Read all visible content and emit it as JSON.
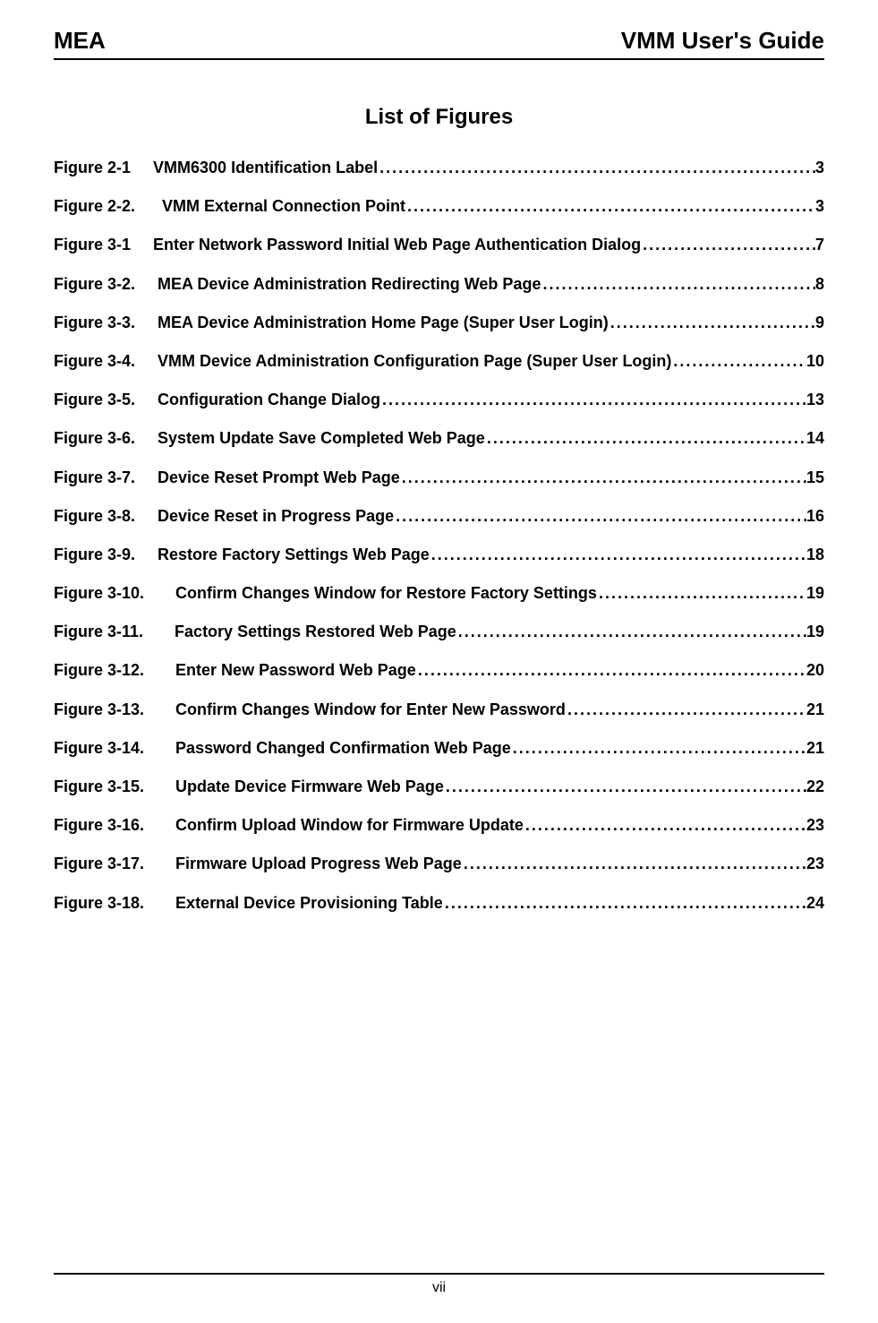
{
  "header": {
    "left": "MEA",
    "right": "VMM User's Guide"
  },
  "title": "List of Figures",
  "entries": [
    {
      "label": "Figure 2-1",
      "spacing": "     ",
      "title": "VMM6300 Identification Label ",
      "page": "3"
    },
    {
      "label": "Figure 2-2.",
      "spacing": "      ",
      "title": "VMM External Connection Point ",
      "page": "3"
    },
    {
      "label": "Figure 3-1",
      "spacing": "     ",
      "title": "Enter Network Password Initial Web Page Authentication Dialog ",
      "page": "7"
    },
    {
      "label": "Figure 3-2.",
      "spacing": "     ",
      "title": "MEA Device Administration Redirecting Web Page",
      "page": "8"
    },
    {
      "label": "Figure 3-3.",
      "spacing": "     ",
      "title": "MEA Device Administration Home Page (Super User Login)",
      "page": "9"
    },
    {
      "label": "Figure 3-4.",
      "spacing": "     ",
      "title": "VMM Device Administration Configuration Page (Super User Login)",
      "page": "10"
    },
    {
      "label": "Figure 3-5.",
      "spacing": "     ",
      "title": "Configuration Change Dialog",
      "page": "13"
    },
    {
      "label": "Figure 3-6.",
      "spacing": "     ",
      "title": "System Update Save Completed Web Page ",
      "page": "14"
    },
    {
      "label": "Figure 3-7.",
      "spacing": "     ",
      "title": "Device Reset Prompt Web Page ",
      "page": "15"
    },
    {
      "label": "Figure 3-8.",
      "spacing": "     ",
      "title": "Device Reset in Progress Page",
      "page": "16"
    },
    {
      "label": "Figure 3-9.",
      "spacing": "     ",
      "title": "Restore Factory Settings Web Page",
      "page": "18"
    },
    {
      "label": "Figure 3-10.",
      "spacing": "       ",
      "title": "Confirm Changes Window for Restore Factory Settings ",
      "page": "19"
    },
    {
      "label": "Figure 3-11.",
      "spacing": "       ",
      "title": "Factory Settings Restored Web Page",
      "page": "19"
    },
    {
      "label": "Figure 3-12.",
      "spacing": "       ",
      "title": "Enter New Password Web Page",
      "page": "20"
    },
    {
      "label": "Figure 3-13.",
      "spacing": "       ",
      "title": "Confirm Changes Window for Enter New Password ",
      "page": "21"
    },
    {
      "label": "Figure 3-14.",
      "spacing": "       ",
      "title": "Password Changed Confirmation Web Page",
      "page": "21"
    },
    {
      "label": "Figure 3-15.",
      "spacing": "       ",
      "title": "Update Device Firmware Web Page",
      "page": "22"
    },
    {
      "label": "Figure 3-16.",
      "spacing": "       ",
      "title": "Confirm Upload Window for Firmware Update",
      "page": "23"
    },
    {
      "label": "Figure 3-17.",
      "spacing": "       ",
      "title": "Firmware Upload Progress Web Page",
      "page": "23"
    },
    {
      "label": "Figure 3-18.",
      "spacing": "       ",
      "title": "External Device Provisioning Table",
      "page": "24"
    }
  ],
  "footer": "vii"
}
